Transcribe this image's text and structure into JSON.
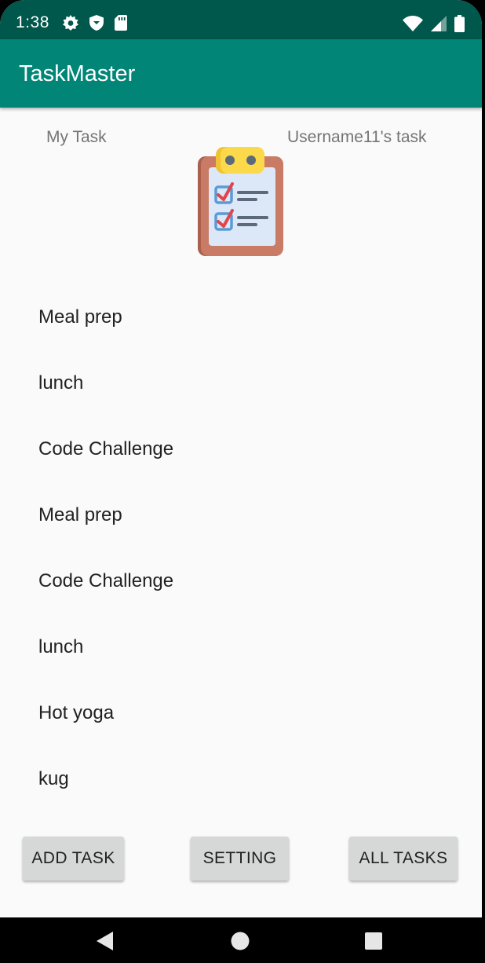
{
  "status_bar": {
    "time": "1:38",
    "icons_left": [
      "gear-icon",
      "shield-icon",
      "sd-card-icon"
    ],
    "icons_right": [
      "wifi-icon",
      "signal-icon",
      "battery-icon"
    ]
  },
  "app_bar": {
    "title": "TaskMaster"
  },
  "header": {
    "left_label": "My Task",
    "right_label": "Username11's task"
  },
  "tasks": [
    {
      "title": "Meal prep"
    },
    {
      "title": "lunch"
    },
    {
      "title": "Code Challenge"
    },
    {
      "title": "Meal prep"
    },
    {
      "title": "Code Challenge"
    },
    {
      "title": "lunch"
    },
    {
      "title": "Hot yoga"
    },
    {
      "title": "kug"
    }
  ],
  "buttons": {
    "add_task": "ADD TASK",
    "setting": "SETTING",
    "all_tasks": "ALL TASKS"
  },
  "nav": {
    "icons": [
      "back-icon",
      "home-icon",
      "recents-icon"
    ]
  },
  "colors": {
    "primary": "#008577",
    "primary_dark": "#00574b",
    "button": "#d6d7d7",
    "background": "#fafafa"
  }
}
